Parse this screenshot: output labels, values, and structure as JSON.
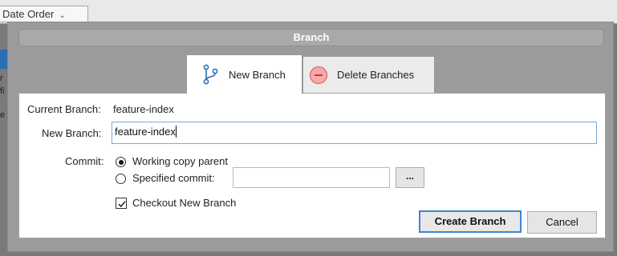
{
  "background": {
    "sort_combo": "Date Order",
    "left_chars": [
      "r",
      "fi",
      "e"
    ]
  },
  "dialog": {
    "title": "Branch",
    "tabs": [
      {
        "label": "New Branch",
        "icon": "branch-icon",
        "active": true
      },
      {
        "label": "Delete Branches",
        "icon": "minus-circle-icon",
        "active": false
      }
    ],
    "current_branch_label": "Current Branch:",
    "current_branch_value": "feature-index",
    "new_branch_label": "New Branch:",
    "new_branch_value": "feature-index",
    "commit_label": "Commit:",
    "commit_options": [
      {
        "label": "Working copy parent",
        "selected": true
      },
      {
        "label": "Specified commit:",
        "selected": false
      }
    ],
    "specified_commit_value": "",
    "browse_label": "...",
    "checkout_label": "Checkout New Branch",
    "checkout_checked": true,
    "create_button": "Create Branch",
    "cancel_button": "Cancel",
    "colors": {
      "accent": "#3b86d4",
      "delete_icon": "#d94f4f",
      "branch_icon": "#2b6fb5"
    }
  }
}
